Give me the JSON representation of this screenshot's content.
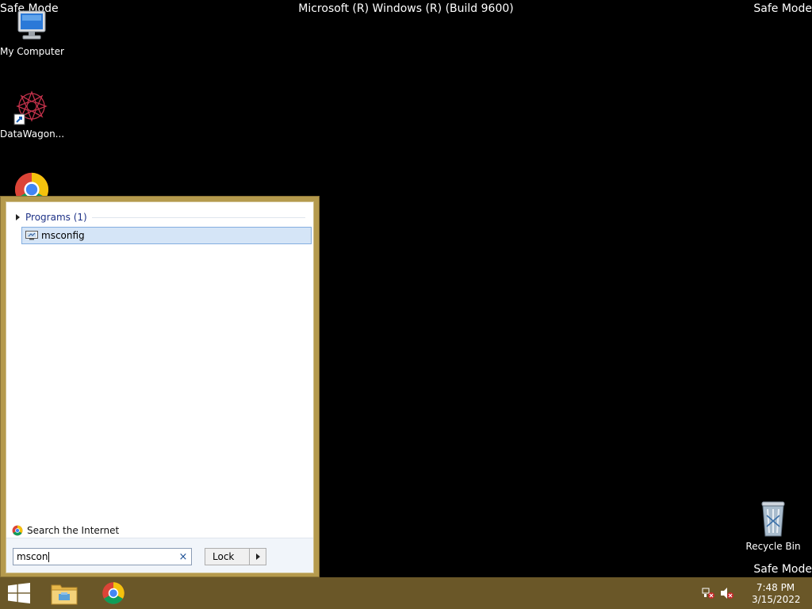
{
  "overlay": {
    "safe_mode": "Safe Mode",
    "build": "Microsoft (R) Windows (R) (Build 9600)"
  },
  "desktop": {
    "icons": [
      {
        "label": "My Computer",
        "icon": "computer-icon"
      },
      {
        "label": "DataWagon...",
        "icon": "datawagon-icon"
      },
      {
        "label": "",
        "icon": "chrome-icon"
      },
      {
        "label": "Recycle Bin",
        "icon": "recycle-bin-icon"
      }
    ]
  },
  "start_menu": {
    "programs_header": "Programs (1)",
    "result_item": "msconfig",
    "search_internet": "Search the Internet",
    "search_value": "mscon",
    "clear_glyph": "×",
    "lock_label": "Lock"
  },
  "taskbar": {
    "items": [
      "start-button",
      "file-explorer",
      "chrome"
    ],
    "time": "7:48 PM",
    "date": "3/15/2022"
  },
  "colors": {
    "accent": "#b59a4d",
    "taskbar": "#6a5728",
    "selection": "#d5e5f7"
  }
}
